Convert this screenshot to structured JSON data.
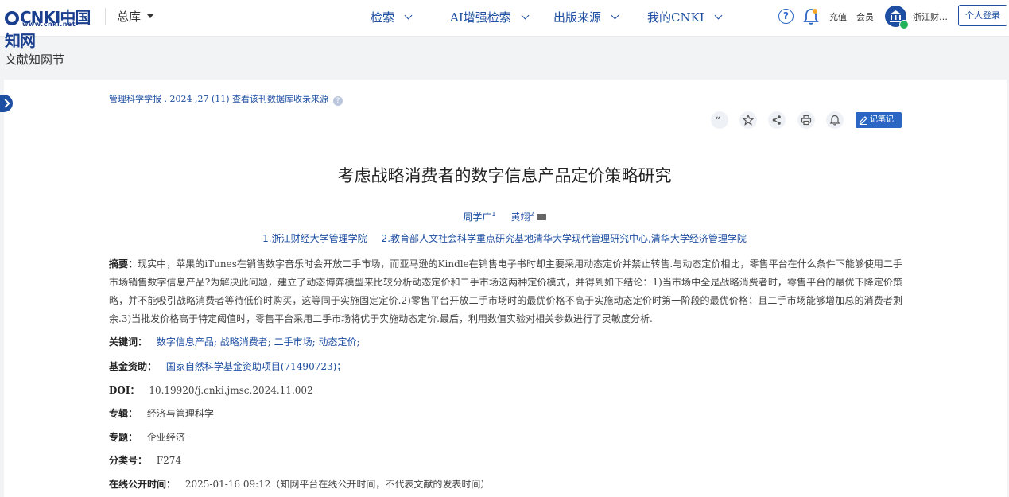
{
  "header": {
    "logo_text": "CNKI中国知网",
    "logo_url_text": "www.cnki.net",
    "db_selector": "总库",
    "nav": [
      "检索",
      "AI增强检索",
      "出版来源",
      "我的CNKI"
    ],
    "recharge": "充值",
    "member": "会员",
    "org": "浙江财…",
    "login": "个人登录"
  },
  "section_title": "文献知网节",
  "article": {
    "journal_line": "管理科学学报 . 2024 ,27 (11)  查看该刊数据库收录来源",
    "note_button": "记笔记",
    "title": "考虑战略消费者的数字信息产品定价策略研究",
    "authors": [
      {
        "name": "周学广",
        "sup": "1"
      },
      {
        "name": "黄翊",
        "sup": "2"
      }
    ],
    "affiliations": [
      "1.浙江财经大学管理学院",
      "2.教育部人文社会科学重点研究基地清华大学现代管理研究中心,清华大学经济管理学院"
    ],
    "abstract_label": "摘要：",
    "abstract": "现实中，苹果的iTunes在销售数字音乐时会开放二手市场，而亚马逊的Kindle在销售电子书时却主要采用动态定价并禁止转售.与动态定价相比，零售平台在什么条件下能够使用二手市场销售数字信息产品?为解决此问题，建立了动态博弈模型来比较分析动态定价和二手市场这两种定价模式，并得到如下结论：1)当市场中全是战略消费者时，零售平台的最优下降定价策略，并不能吸引战略消费者等待低价时购买，这等同于实施固定定价.2)零售平台开放二手市场时的最优价格不高于实施动态定价时第一阶段的最优价格；且二手市场能够增加总的消费者剩余.3)当批发价格高于特定阈值时，零售平台采用二手市场将优于实施动态定价.最后，利用数值实验对相关参数进行了灵敏度分析.",
    "keywords_label": "关键词：",
    "keywords": [
      "数字信息产品;",
      "战略消费者;",
      "二手市场;",
      "动态定价;"
    ],
    "fund_label": "基金资助：",
    "fund": "国家自然科学基金资助项目(71490723)；",
    "doi_label": "DOI：",
    "doi": "10.19920/j.cnki.jmsc.2024.11.002",
    "album_label": "专辑：",
    "album": "经济与管理科学",
    "topic_label": "专题：",
    "topic": "企业经济",
    "class_label": "分类号：",
    "class_no": "F274",
    "online_label": "在线公开时间：",
    "online": "2025-01-16 09:12（知网平台在线公开时间，不代表文献的发表时间）"
  },
  "icons": [
    "quote-icon",
    "star-icon",
    "share-icon",
    "print-icon",
    "bell-icon",
    "pencil-icon",
    "help-icon",
    "mail-icon"
  ]
}
